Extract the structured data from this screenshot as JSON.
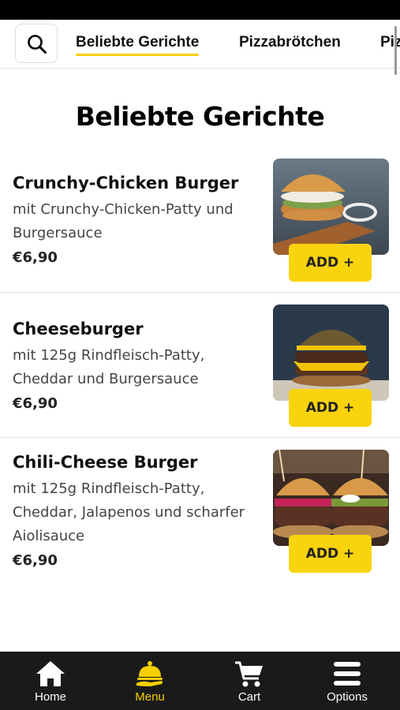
{
  "categories": {
    "tabs": [
      {
        "label": "Beliebte Gerichte",
        "active": true
      },
      {
        "label": "Pizzabrötchen",
        "active": false
      },
      {
        "label": "Piz",
        "active": false
      }
    ]
  },
  "section": {
    "title": "Beliebte Gerichte"
  },
  "items": [
    {
      "name": "Crunchy-Chicken Burger",
      "description": "mit Crunchy-Chicken-Patty und Burgersauce",
      "price": "€6,90",
      "add_label": "ADD +"
    },
    {
      "name": "Cheeseburger",
      "description": "mit 125g Rindfleisch-Patty, Cheddar und Burgersauce",
      "price": "€6,90",
      "add_label": "ADD +"
    },
    {
      "name": "Chili-Cheese Burger",
      "description": "mit 125g Rindfleisch-Patty, Cheddar, Jalapenos und scharfer Aiolisauce",
      "price": "€6,90",
      "add_label": "ADD +"
    }
  ],
  "nav": {
    "items": [
      {
        "label": "Home",
        "icon": "home-icon",
        "active": false
      },
      {
        "label": "Menu",
        "icon": "menu-cloche-icon",
        "active": true
      },
      {
        "label": "Cart",
        "icon": "cart-icon",
        "active": false
      },
      {
        "label": "Options",
        "icon": "hamburger-icon",
        "active": false
      }
    ]
  },
  "colors": {
    "accent": "#f9d30c",
    "nav_background": "#1a1a1a",
    "active_nav": "#f5d000"
  }
}
